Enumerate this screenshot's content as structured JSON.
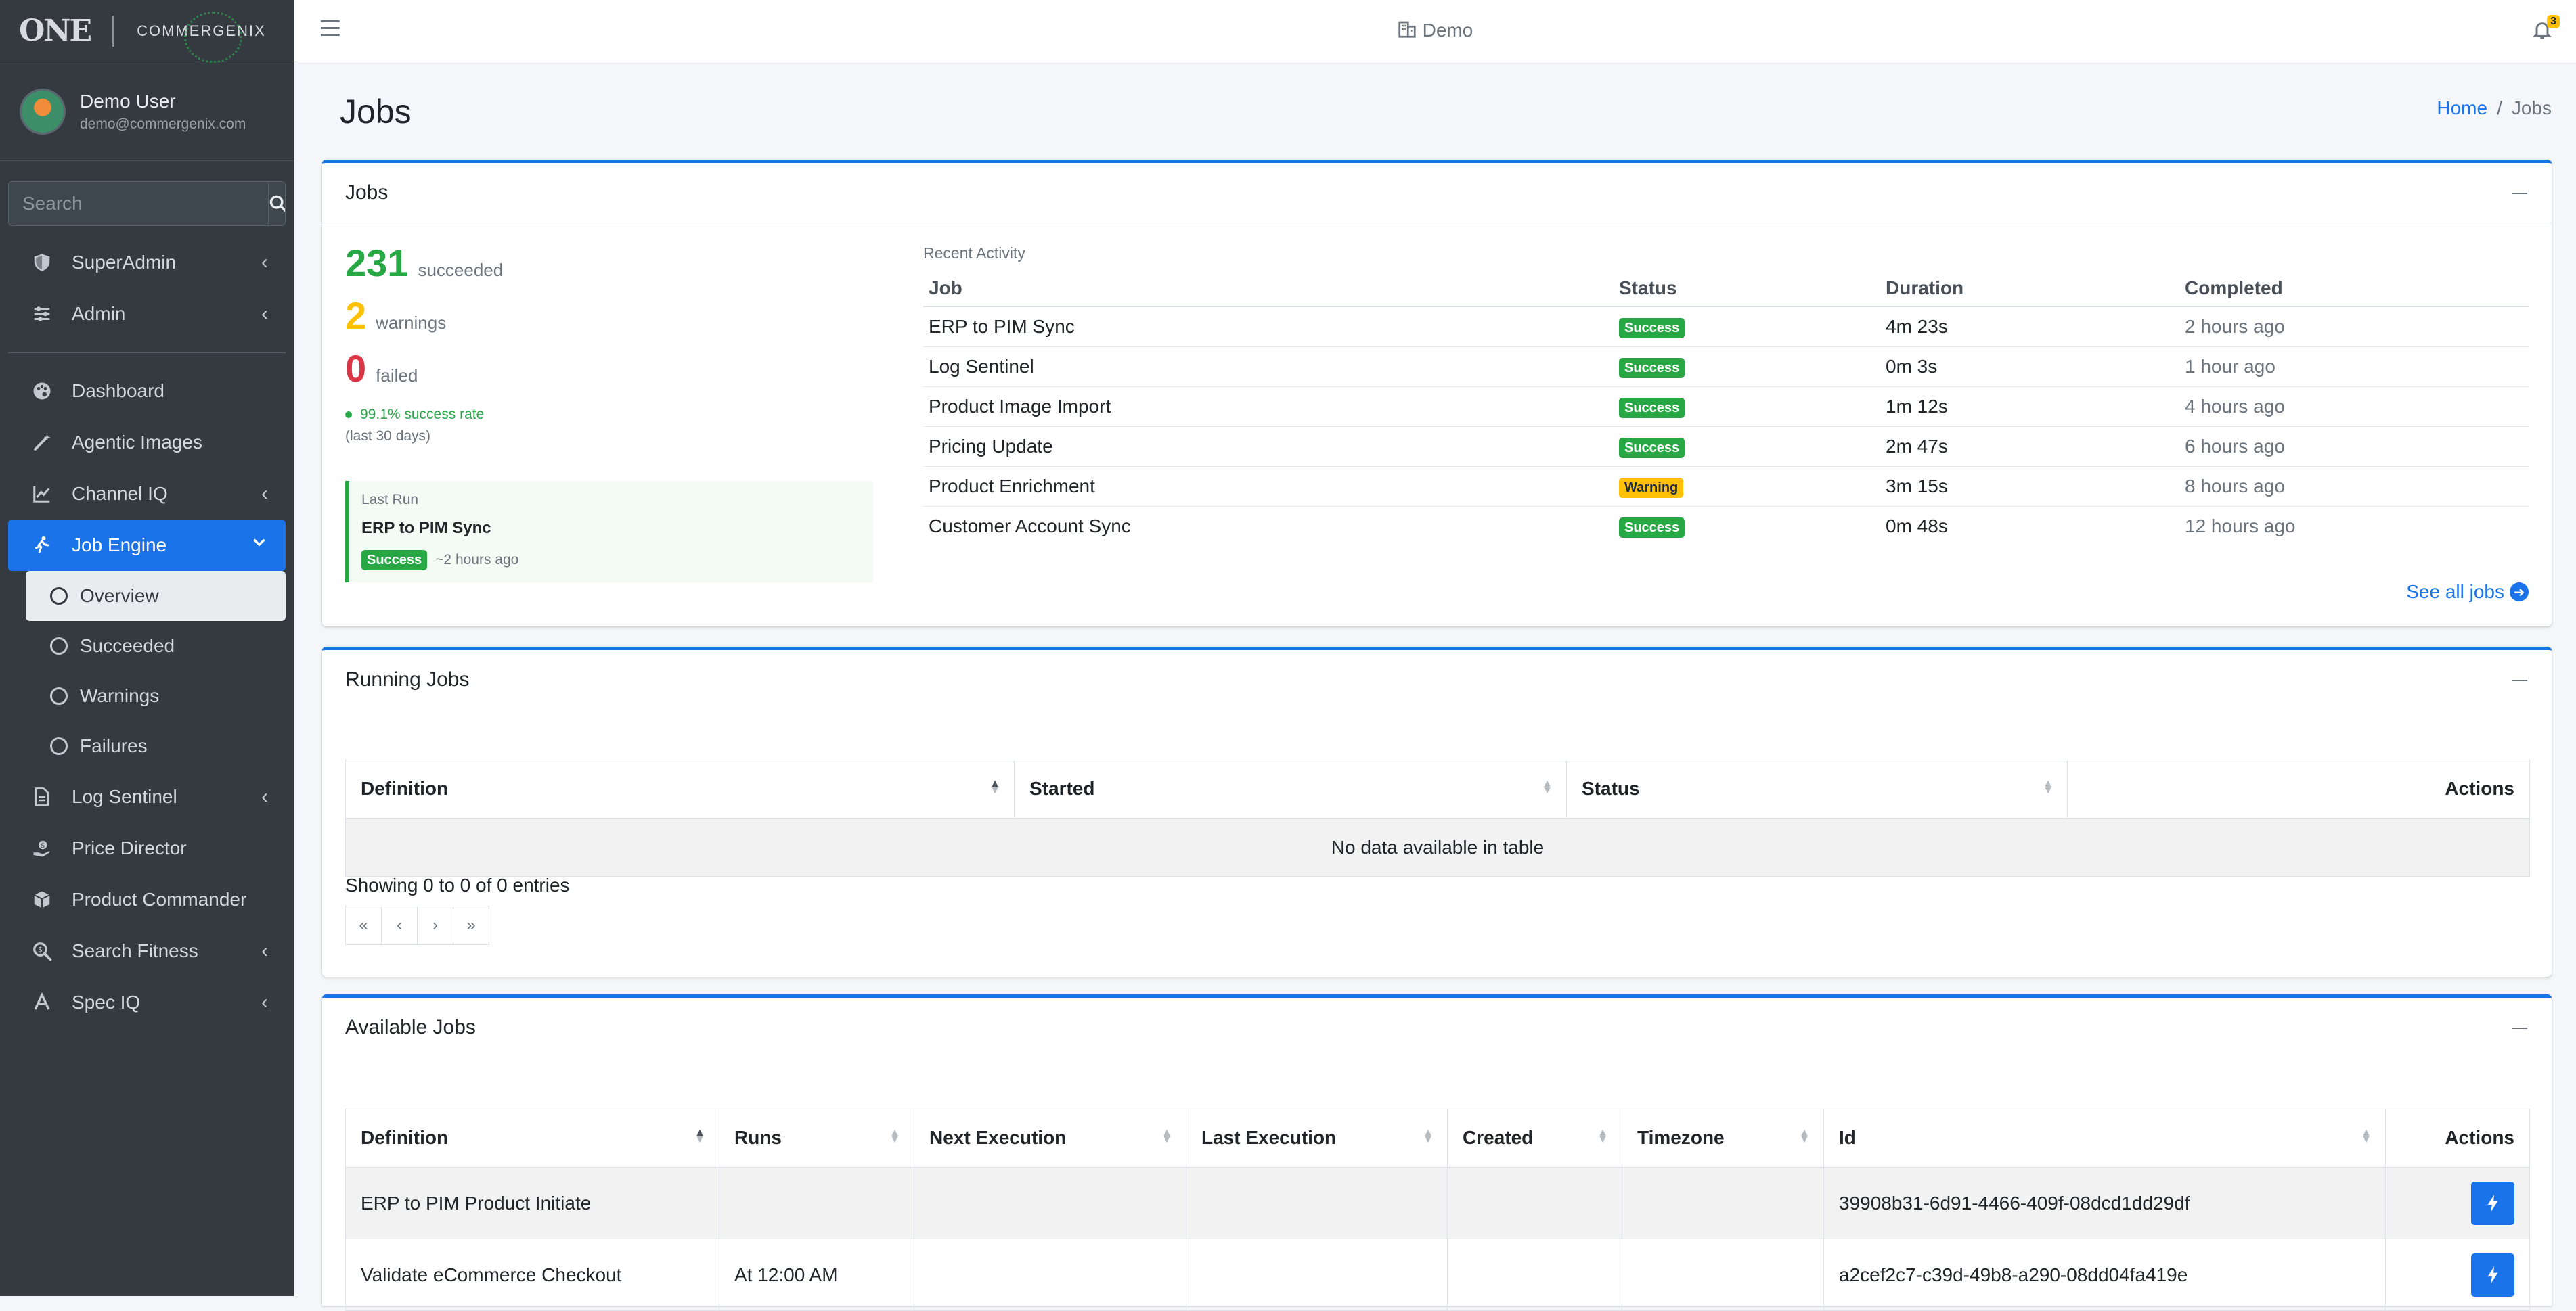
{
  "brand": {
    "logo_left": "ONE",
    "logo_right": "COMMERGENIX"
  },
  "user": {
    "name": "Demo User",
    "email": "demo@commergenix.com"
  },
  "search": {
    "placeholder": "Search"
  },
  "nav": {
    "top": [
      {
        "label": "SuperAdmin",
        "icon": "shield-icon",
        "chevron": "‹"
      },
      {
        "label": "Admin",
        "icon": "sliders-icon",
        "chevron": "‹"
      }
    ],
    "main": [
      {
        "label": "Dashboard",
        "icon": "palette-icon"
      },
      {
        "label": "Agentic Images",
        "icon": "magic-wand-icon"
      },
      {
        "label": "Channel IQ",
        "icon": "line-chart-icon",
        "chevron": "‹"
      },
      {
        "label": "Job Engine",
        "icon": "running-icon",
        "chevron": "⌄"
      }
    ],
    "job_engine_sub": [
      "Overview",
      "Succeeded",
      "Warnings",
      "Failures"
    ],
    "rest": [
      {
        "label": "Log Sentinel",
        "icon": "file-icon",
        "chevron": "‹"
      },
      {
        "label": "Price Director",
        "icon": "hand-dollar-icon"
      },
      {
        "label": "Product Commander",
        "icon": "box-icon"
      },
      {
        "label": "Search Fitness",
        "icon": "search-dollar-icon",
        "chevron": "‹"
      },
      {
        "label": "Spec IQ",
        "icon": "ruler-icon",
        "chevron": "‹"
      }
    ]
  },
  "topbar": {
    "tenant": "Demo",
    "notifications": "3"
  },
  "page": {
    "title": "Jobs",
    "breadcrumb_home": "Home",
    "breadcrumb_sep": "/",
    "breadcrumb_current": "Jobs"
  },
  "jobs_card": {
    "title": "Jobs",
    "succeeded": "231",
    "succeeded_label": "succeeded",
    "warnings": "2",
    "warnings_label": "warnings",
    "failed": "0",
    "failed_label": "failed",
    "rate": "99.1% success rate",
    "period": "(last 30 days)",
    "last_run": {
      "label": "Last Run",
      "job": "ERP to PIM Sync",
      "status": "Success",
      "when": "~2 hours ago"
    },
    "recent_title": "Recent Activity",
    "columns": [
      "Job",
      "Status",
      "Duration",
      "Completed"
    ],
    "rows": [
      {
        "job": "ERP to PIM Sync",
        "status": "Success",
        "duration": "4m 23s",
        "completed": "2 hours ago"
      },
      {
        "job": "Log Sentinel",
        "status": "Success",
        "duration": "0m 3s",
        "completed": "1 hour ago"
      },
      {
        "job": "Product Image Import",
        "status": "Success",
        "duration": "1m 12s",
        "completed": "4 hours ago"
      },
      {
        "job": "Pricing Update",
        "status": "Success",
        "duration": "2m 47s",
        "completed": "6 hours ago"
      },
      {
        "job": "Product Enrichment",
        "status": "Warning",
        "duration": "3m 15s",
        "completed": "8 hours ago"
      },
      {
        "job": "Customer Account Sync",
        "status": "Success",
        "duration": "0m 48s",
        "completed": "12 hours ago"
      }
    ],
    "see_all": "See all jobs"
  },
  "running_card": {
    "title": "Running Jobs",
    "columns": [
      "Definition",
      "Started",
      "Status",
      "Actions"
    ],
    "empty": "No data available in table",
    "showing": "Showing 0 to 0 of 0 entries",
    "pager": [
      "«",
      "‹",
      "›",
      "»"
    ]
  },
  "available_card": {
    "title": "Available Jobs",
    "columns": [
      "Definition",
      "Runs",
      "Next Execution",
      "Last Execution",
      "Created",
      "Timezone",
      "Id",
      "Actions"
    ],
    "rows": [
      {
        "definition": "ERP to PIM Product Initiate",
        "runs": "",
        "next": "",
        "last": "",
        "created": "",
        "timezone": "",
        "id": "39908b31-6d91-4466-409f-08dcd1dd29df"
      },
      {
        "definition": "Validate eCommerce Checkout",
        "runs": "At 12:00 AM",
        "next": "",
        "last": "",
        "created": "",
        "timezone": "",
        "id": "a2cef2c7-c39d-49b8-a290-08dd04fa419e"
      }
    ]
  },
  "colors": {
    "primary": "#1a73e8",
    "success": "#28a745",
    "warning": "#ffc107",
    "danger": "#dc3545",
    "sidebar": "#343a40"
  }
}
